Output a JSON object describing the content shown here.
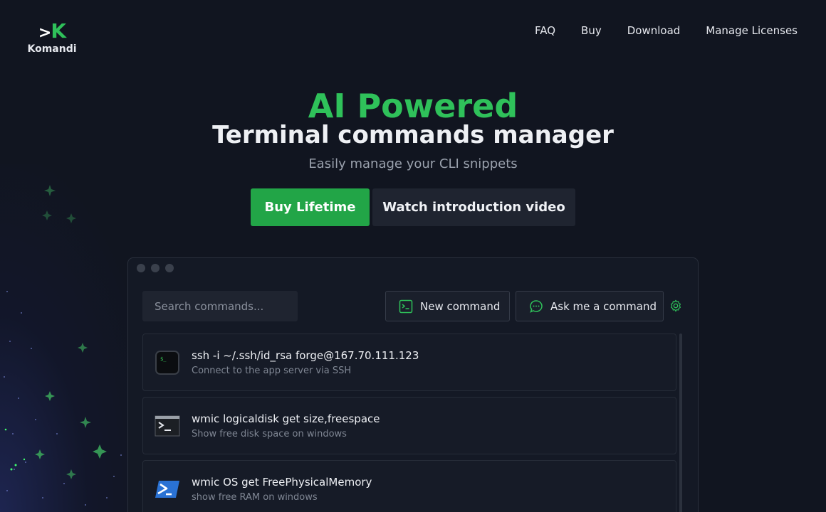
{
  "brand": {
    "mark_gt": ">",
    "mark_k": "K",
    "name": "Komandi"
  },
  "nav": {
    "items": [
      "FAQ",
      "Buy",
      "Download",
      "Manage Licenses"
    ]
  },
  "hero": {
    "headline": "AI Powered",
    "subheadline": "Terminal commands manager",
    "tagline": "Easily manage your CLI snippets",
    "buy_label": "Buy Lifetime",
    "video_label": "Watch introduction video"
  },
  "app": {
    "search_placeholder": "Search commands...",
    "new_command_label": "New command",
    "ask_label": "Ask me a command",
    "commands": [
      {
        "icon": "terminal-dark-icon",
        "command": "ssh -i ~/.ssh/id_rsa forge@167.70.111.123",
        "description": "Connect to the app server via SSH"
      },
      {
        "icon": "cmd-prompt-icon",
        "command": "wmic logicaldisk get size,freespace",
        "description": "Show free disk space on windows"
      },
      {
        "icon": "powershell-icon",
        "command": "wmic OS get FreePhysicalMemory",
        "description": "show free RAM on windows"
      }
    ]
  },
  "colors": {
    "accent": "#22a547",
    "accent_text": "#2fc15a",
    "background": "#111520",
    "panel": "#141925"
  }
}
